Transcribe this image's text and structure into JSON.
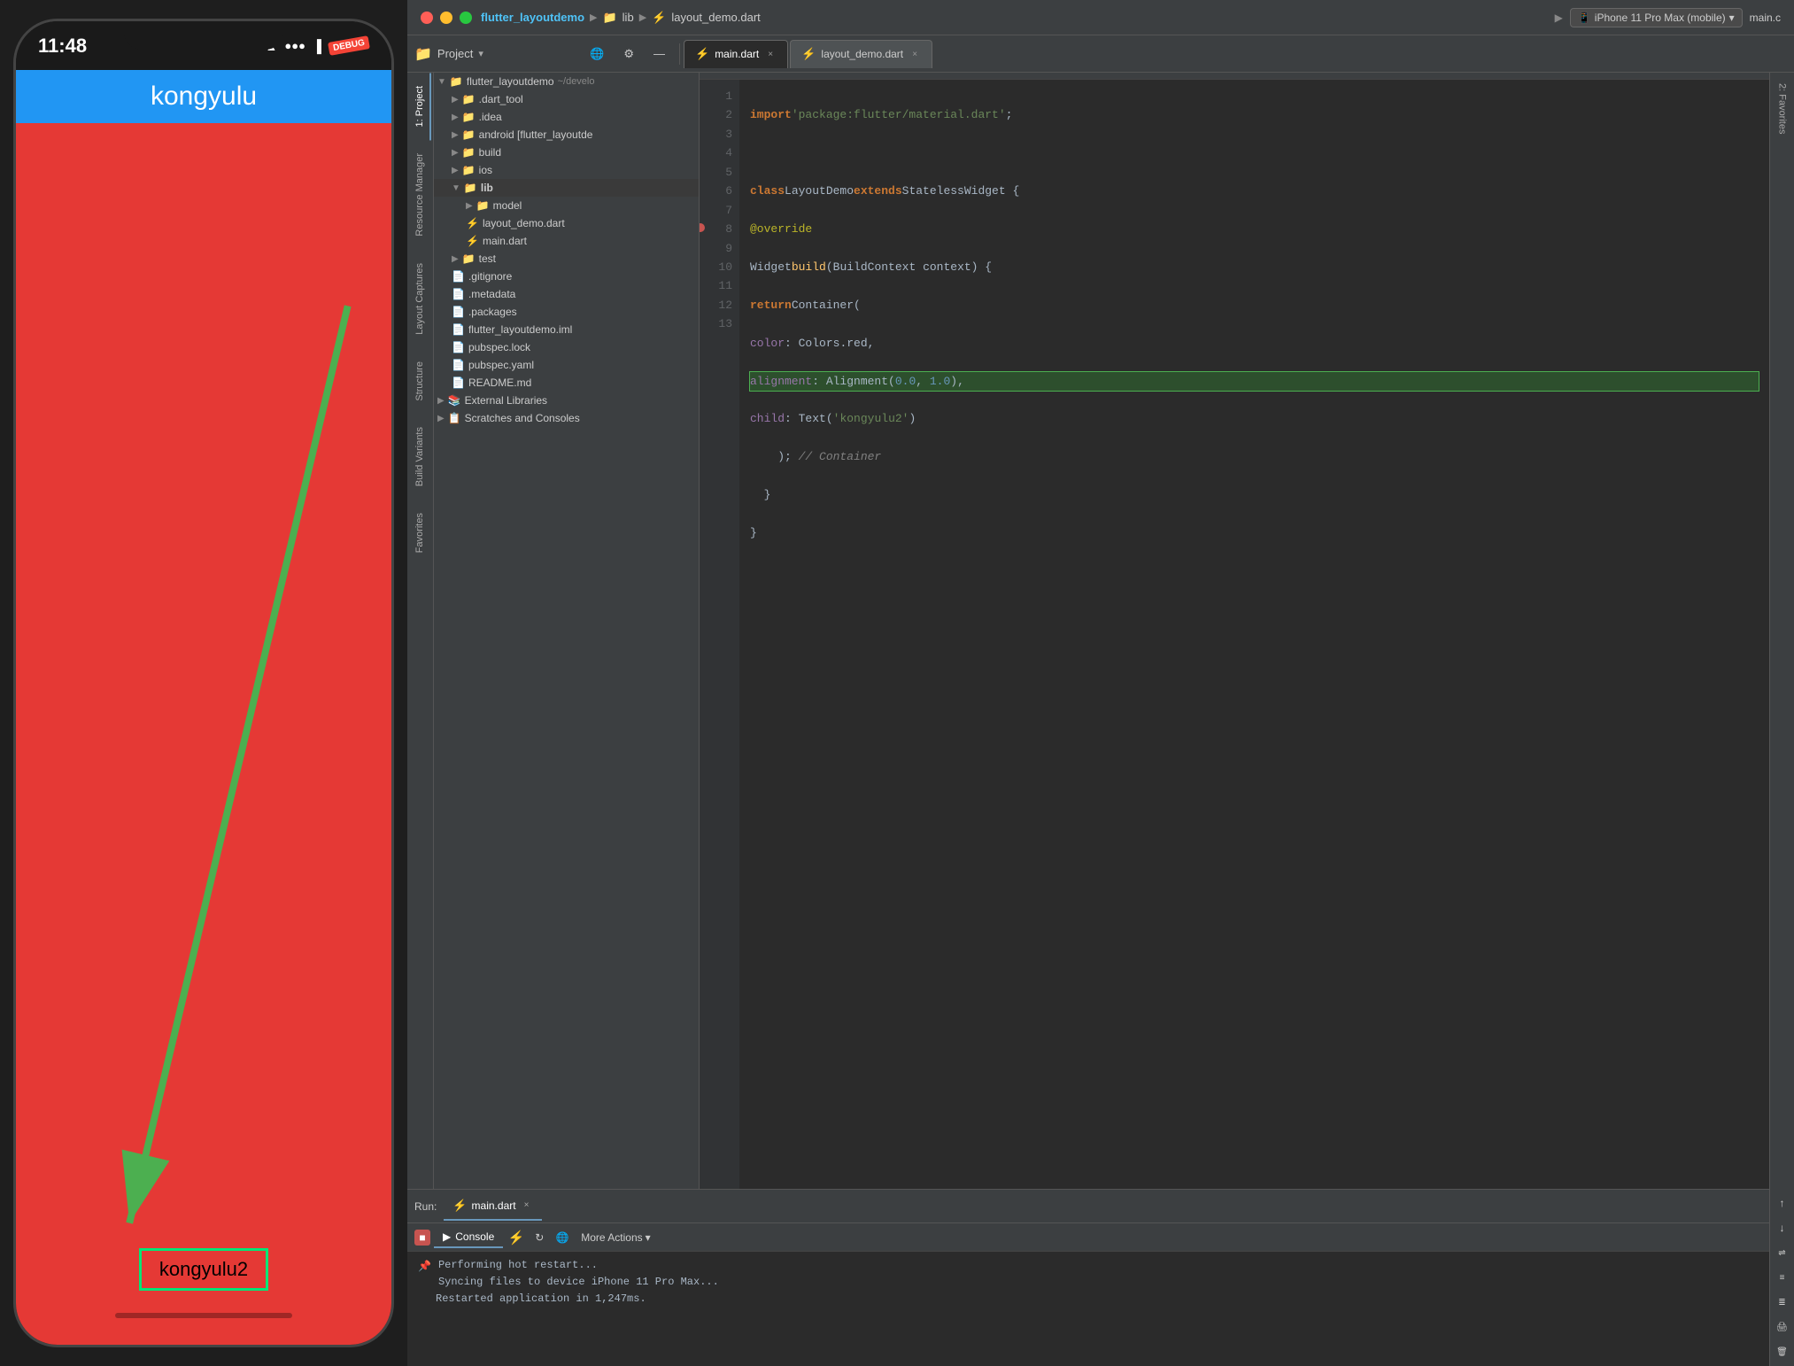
{
  "phone": {
    "time": "11:48",
    "app_title": "kongyulu",
    "label_bottom": "kongyulu2",
    "status_color": "#2196F3",
    "screen_color": "#e53935"
  },
  "ide": {
    "title": {
      "project": "flutter_layoutdemo",
      "path1": "lib",
      "path2": "layout_demo.dart",
      "device": "iPhone 11 Pro Max (mobile)",
      "tab_right": "main.c"
    },
    "tabs": [
      {
        "label": "main.dart",
        "active": true
      },
      {
        "label": "layout_demo.dart",
        "active": false
      }
    ],
    "toolbar": {
      "project_label": "Project",
      "settings_label": "⚙",
      "horizontal_layout": "⠿"
    },
    "file_tree": {
      "root": "flutter_layoutdemo",
      "root_path": "~/develo",
      "items": [
        {
          "name": ".dart_tool",
          "type": "folder",
          "indent": 1
        },
        {
          "name": ".idea",
          "type": "folder",
          "indent": 1
        },
        {
          "name": "android [flutter_layoutde",
          "type": "folder",
          "indent": 1
        },
        {
          "name": "build",
          "type": "folder",
          "indent": 1
        },
        {
          "name": "ios",
          "type": "folder",
          "indent": 1
        },
        {
          "name": "lib",
          "type": "folder-open",
          "indent": 1
        },
        {
          "name": "model",
          "type": "folder",
          "indent": 2
        },
        {
          "name": "layout_demo.dart",
          "type": "dart",
          "indent": 2
        },
        {
          "name": "main.dart",
          "type": "dart",
          "indent": 2
        },
        {
          "name": "test",
          "type": "folder",
          "indent": 1
        },
        {
          "name": ".gitignore",
          "type": "file",
          "indent": 1
        },
        {
          "name": ".metadata",
          "type": "file",
          "indent": 1
        },
        {
          "name": ".packages",
          "type": "file",
          "indent": 1
        },
        {
          "name": "flutter_layoutdemo.iml",
          "type": "file",
          "indent": 1
        },
        {
          "name": "pubspec.lock",
          "type": "file",
          "indent": 1
        },
        {
          "name": "pubspec.yaml",
          "type": "file",
          "indent": 1
        },
        {
          "name": "README.md",
          "type": "file",
          "indent": 1
        },
        {
          "name": "External Libraries",
          "type": "folder",
          "indent": 0
        },
        {
          "name": "Scratches and Consoles",
          "type": "folder",
          "indent": 0
        }
      ]
    },
    "code": {
      "lines": [
        {
          "num": 1,
          "text": "import 'package:flutter/material.dart';"
        },
        {
          "num": 2,
          "text": ""
        },
        {
          "num": 3,
          "text": "class LayoutDemo extends StatelessWidget {"
        },
        {
          "num": 4,
          "text": "  @override"
        },
        {
          "num": 5,
          "text": "  Widget build(BuildContext context) {"
        },
        {
          "num": 6,
          "text": "    return Container("
        },
        {
          "num": 7,
          "text": "      color: Colors.red,"
        },
        {
          "num": 8,
          "text": "      alignment: Alignment(0.0, 1.0),"
        },
        {
          "num": 9,
          "text": "      child: Text('kongyulu2')"
        },
        {
          "num": 10,
          "text": "    ); // Container"
        },
        {
          "num": 11,
          "text": "  }"
        },
        {
          "num": 12,
          "text": "}"
        },
        {
          "num": 13,
          "text": ""
        }
      ]
    },
    "side_tabs": {
      "left": [
        "1: Project",
        "Resource Manager",
        "Layout Captures",
        "Structure",
        "Build Variants",
        "Favorites",
        "2: Favorites"
      ],
      "right": [
        "main.c"
      ]
    },
    "bottom_panel": {
      "run_label": "Run:",
      "tab_label": "main.dart",
      "console_label": "Console",
      "more_actions": "More Actions",
      "output": [
        "Performing hot restart...",
        "Syncing files to device iPhone 11 Pro Max...",
        "Restarted application in 1,247ms."
      ]
    }
  }
}
